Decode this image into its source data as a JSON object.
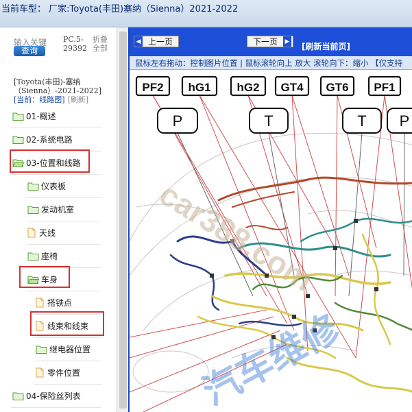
{
  "window": {
    "title": "当前车型：  厂家:Toyota(丰田)塞纳（Sienna）2021-2022"
  },
  "sidebar": {
    "search_label": "输入关键",
    "search_button": "查询",
    "pc_line1": "PC.5-",
    "pc_line2": "29392",
    "fold_line1": "折叠",
    "fold_line2": "全部",
    "vehicle_line1": "[Toyota(丰田)-塞纳",
    "vehicle_line2": "（Sienna）-2021-2022]",
    "current_label": "[当前：线路图]",
    "current_refresh": "[刷新]",
    "items": [
      {
        "label": "01-概述"
      },
      {
        "label": "02-系统电路"
      },
      {
        "label": "03-位置和线路"
      },
      {
        "label": "仪表板"
      },
      {
        "label": "发动机室"
      },
      {
        "label": "天线"
      },
      {
        "label": "座椅"
      },
      {
        "label": "车身"
      },
      {
        "label": "搭铁点"
      },
      {
        "label": "线束和线束"
      },
      {
        "label": "继电器位置"
      },
      {
        "label": "零件位置"
      },
      {
        "label": "04-保险丝列表"
      }
    ]
  },
  "viewer": {
    "prev_button": "上一页",
    "next_button": "下一页",
    "refresh_page": "[刷新当前页]",
    "hint": "鼠标左右拖动：控制图片位置 | 鼠标滚轮向上 放大  滚轮向下：缩小 【仅支持"
  },
  "diagram": {
    "connectors": [
      "PF2",
      "hG1",
      "hG2",
      "GT4",
      "GT6",
      "PF1"
    ],
    "ground_tags": [
      "P",
      "T",
      "T",
      "P"
    ],
    "watermark": "car388.com",
    "watermark2": "汽车维修",
    "colors": {
      "harness_red": "#b5482a",
      "harness_yellow": "#d8c94a",
      "harness_blue": "#2a3f8a",
      "harness_teal": "#2e8f8a",
      "harness_green": "#4f8a3a",
      "leader_line": "#d05050"
    }
  }
}
